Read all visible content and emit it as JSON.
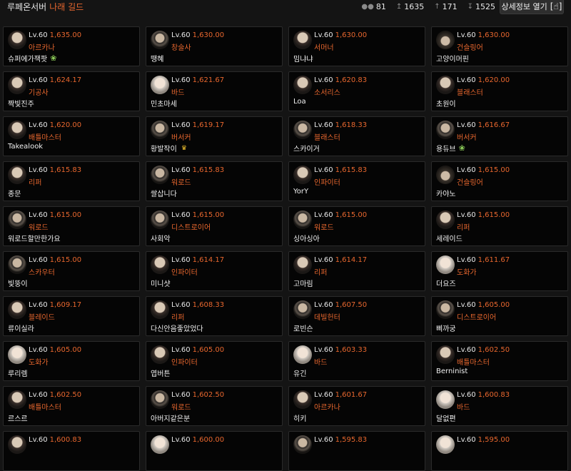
{
  "header": {
    "server": "루페온서버",
    "guild": "나래 길드",
    "members": "81",
    "stat_max": "1635",
    "stat_avg": "171",
    "stat_min": "1525",
    "detail_button": "상세정보 열기"
  },
  "cards": [
    {
      "level": "Lv.60",
      "score": "1,635.00",
      "class": "아르카나",
      "name": "슈퍼에가잭팟",
      "badge": "sprout",
      "avatar": "av-dark"
    },
    {
      "level": "Lv.60",
      "score": "1,630.00",
      "class": "창술사",
      "name": "땡혜",
      "badge": "",
      "avatar": "av-mask"
    },
    {
      "level": "Lv.60",
      "score": "1,630.00",
      "class": "서머너",
      "name": "밈냐냐",
      "badge": "",
      "avatar": "av-dark"
    },
    {
      "level": "Lv.60",
      "score": "1,630.00",
      "class": "건슬링어",
      "name": "고양이머핀",
      "badge": "",
      "avatar": "av-hat"
    },
    {
      "level": "Lv.60",
      "score": "1,624.17",
      "class": "기공사",
      "name": "짝빛진주",
      "badge": "",
      "avatar": "av-dark"
    },
    {
      "level": "Lv.60",
      "score": "1,621.67",
      "class": "바드",
      "name": "민초마세",
      "badge": "",
      "avatar": "av-light"
    },
    {
      "level": "Lv.60",
      "score": "1,620.83",
      "class": "소서리스",
      "name": "Loa",
      "badge": "",
      "avatar": "av-dark"
    },
    {
      "level": "Lv.60",
      "score": "1,620.00",
      "class": "블래스터",
      "name": "초원이",
      "badge": "",
      "avatar": "av-dark"
    },
    {
      "level": "Lv.60",
      "score": "1,620.00",
      "class": "배틀마스터",
      "name": "Takealook",
      "badge": "",
      "avatar": "av-dark"
    },
    {
      "level": "Lv.60",
      "score": "1,619.17",
      "class": "버서커",
      "name": "황발작이",
      "badge": "crown",
      "avatar": "av-mask"
    },
    {
      "level": "Lv.60",
      "score": "1,618.33",
      "class": "블래스터",
      "name": "스카이거",
      "badge": "",
      "avatar": "av-mask"
    },
    {
      "level": "Lv.60",
      "score": "1,616.67",
      "class": "버서커",
      "name": "용듀브",
      "badge": "sprout",
      "avatar": "av-mask"
    },
    {
      "level": "Lv.60",
      "score": "1,615.83",
      "class": "리퍼",
      "name": "종문",
      "badge": "",
      "avatar": "av-dark"
    },
    {
      "level": "Lv.60",
      "score": "1,615.83",
      "class": "워로드",
      "name": "쌀삽니다",
      "badge": "",
      "avatar": "av-mask"
    },
    {
      "level": "Lv.60",
      "score": "1,615.83",
      "class": "인파이터",
      "name": "YorY",
      "badge": "",
      "avatar": "av-dark"
    },
    {
      "level": "Lv.60",
      "score": "1,615.00",
      "class": "건슬링어",
      "name": "카야노",
      "badge": "",
      "avatar": "av-hat"
    },
    {
      "level": "Lv.60",
      "score": "1,615.00",
      "class": "워로드",
      "name": "워로드할만한가요",
      "badge": "",
      "avatar": "av-mask"
    },
    {
      "level": "Lv.60",
      "score": "1,615.00",
      "class": "디스트로이어",
      "name": "사회악",
      "badge": "",
      "avatar": "av-mask"
    },
    {
      "level": "Lv.60",
      "score": "1,615.00",
      "class": "워로드",
      "name": "싱아싱아",
      "badge": "",
      "avatar": "av-mask"
    },
    {
      "level": "Lv.60",
      "score": "1,615.00",
      "class": "리퍼",
      "name": "세레이드",
      "badge": "",
      "avatar": "av-dark"
    },
    {
      "level": "Lv.60",
      "score": "1,615.00",
      "class": "스카우터",
      "name": "빛뚱이",
      "badge": "",
      "avatar": "av-mask"
    },
    {
      "level": "Lv.60",
      "score": "1,614.17",
      "class": "인파이터",
      "name": "미니샷",
      "badge": "",
      "avatar": "av-dark"
    },
    {
      "level": "Lv.60",
      "score": "1,614.17",
      "class": "리퍼",
      "name": "고마림",
      "badge": "",
      "avatar": "av-dark"
    },
    {
      "level": "Lv.60",
      "score": "1,611.67",
      "class": "도화가",
      "name": "더요즈",
      "badge": "",
      "avatar": "av-light"
    },
    {
      "level": "Lv.60",
      "score": "1,609.17",
      "class": "블레이드",
      "name": "류이실라",
      "badge": "",
      "avatar": "av-dark"
    },
    {
      "level": "Lv.60",
      "score": "1,608.33",
      "class": "리퍼",
      "name": "다신안음좋았었다",
      "badge": "",
      "avatar": "av-dark"
    },
    {
      "level": "Lv.60",
      "score": "1,607.50",
      "class": "데빌헌터",
      "name": "로빈슨",
      "badge": "",
      "avatar": "av-mask"
    },
    {
      "level": "Lv.60",
      "score": "1,605.00",
      "class": "디스트로이어",
      "name": "삐까궁",
      "badge": "",
      "avatar": "av-mask"
    },
    {
      "level": "Lv.60",
      "score": "1,605.00",
      "class": "도화가",
      "name": "루리렘",
      "badge": "",
      "avatar": "av-light"
    },
    {
      "level": "Lv.60",
      "score": "1,605.00",
      "class": "인파이터",
      "name": "엽버튼",
      "badge": "",
      "avatar": "av-dark"
    },
    {
      "level": "Lv.60",
      "score": "1,603.33",
      "class": "바드",
      "name": "유긴",
      "badge": "",
      "avatar": "av-light"
    },
    {
      "level": "Lv.60",
      "score": "1,602.50",
      "class": "배틀마스터",
      "name": "Berninist",
      "badge": "",
      "avatar": "av-dark"
    },
    {
      "level": "Lv.60",
      "score": "1,602.50",
      "class": "배틀마스터",
      "name": "르스르",
      "badge": "",
      "avatar": "av-dark"
    },
    {
      "level": "Lv.60",
      "score": "1,602.50",
      "class": "워로드",
      "name": "아버지같은분",
      "badge": "",
      "avatar": "av-mask"
    },
    {
      "level": "Lv.60",
      "score": "1,601.67",
      "class": "아르카나",
      "name": "히키",
      "badge": "",
      "avatar": "av-dark"
    },
    {
      "level": "Lv.60",
      "score": "1,600.83",
      "class": "바드",
      "name": "달없편",
      "badge": "",
      "avatar": "av-light"
    },
    {
      "level": "Lv.60",
      "score": "1,600.83",
      "class": "",
      "name": "",
      "badge": "",
      "avatar": "av-dark"
    },
    {
      "level": "Lv.60",
      "score": "1,600.00",
      "class": "",
      "name": "",
      "badge": "",
      "avatar": "av-light"
    },
    {
      "level": "Lv.60",
      "score": "1,595.83",
      "class": "",
      "name": "",
      "badge": "",
      "avatar": "av-mask"
    },
    {
      "level": "Lv.60",
      "score": "1,595.00",
      "class": "",
      "name": "",
      "badge": "",
      "avatar": "av-light"
    }
  ]
}
